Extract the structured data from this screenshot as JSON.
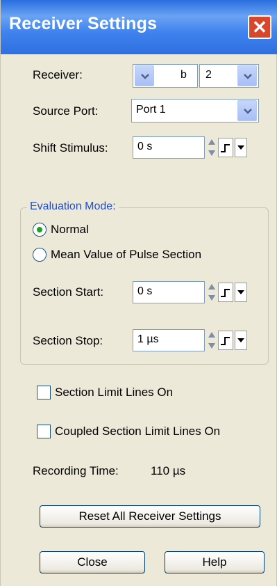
{
  "window": {
    "title": "Receiver Settings",
    "close_glyph": "✕"
  },
  "receiver": {
    "label": "Receiver:",
    "letter": "b",
    "number": "2"
  },
  "source_port": {
    "label": "Source Port:",
    "value": "Port 1"
  },
  "shift_stimulus": {
    "label": "Shift Stimulus:",
    "value": "0 s"
  },
  "evaluation_mode": {
    "title": "Evaluation Mode:",
    "options": [
      {
        "label": "Normal",
        "selected": true
      },
      {
        "label": "Mean Value of Pulse Section",
        "selected": false
      }
    ],
    "section_start": {
      "label": "Section Start:",
      "value": "0 s"
    },
    "section_stop": {
      "label": "Section Stop:",
      "value": "1 µs"
    }
  },
  "checkboxes": [
    {
      "label": "Section Limit Lines On",
      "checked": false
    },
    {
      "label": "Coupled Section Limit Lines On",
      "checked": false
    }
  ],
  "recording_time": {
    "label": "Recording Time:",
    "value": "110 µs"
  },
  "buttons": {
    "reset": "Reset All Receiver Settings",
    "close": "Close",
    "help": "Help"
  },
  "colors": {
    "title_bar": "#2f6fe0",
    "dialog_bg": "#ece9d8",
    "group_title": "#1f4fcf",
    "close_button": "#d8472c"
  }
}
